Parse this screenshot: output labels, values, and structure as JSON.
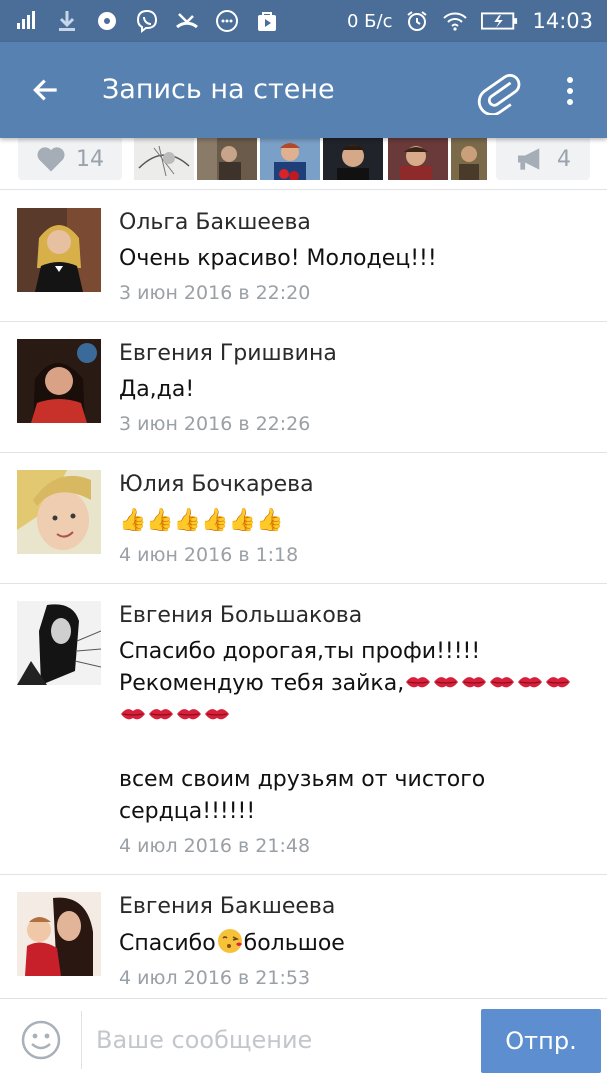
{
  "status_bar": {
    "network_speed": "0 Б/с",
    "time": "14:03",
    "icons": [
      "signal-icon",
      "download-icon",
      "record-icon",
      "viber-icon",
      "missed-call-icon",
      "chat-icon",
      "play-store-icon",
      "alarm-icon",
      "wifi-icon",
      "battery-charging-icon"
    ]
  },
  "app_bar": {
    "title": "Запись на стене",
    "back_icon": "arrow-left-icon",
    "attach_icon": "paperclip-icon",
    "more_icon": "more-vert-icon"
  },
  "likes": {
    "like_count": "14",
    "share_count": "4",
    "like_icon": "heart-icon",
    "share_icon": "megaphone-icon"
  },
  "comments": [
    {
      "author": "Ольга Бакшеева",
      "text": "Очень красиво! Молодец!!!",
      "date": "3 июн 2016 в 22:20"
    },
    {
      "author": "Евгения Гришвина",
      "text": "Да,да!",
      "date": "3 июн 2016 в 22:26"
    },
    {
      "author": "Юлия Бочкарева",
      "text": "👍👍👍👍👍👍",
      "date": "4 июн 2016 в 1:18"
    },
    {
      "author": "Евгения Большакова",
      "text_line1": "Спасибо дорогая,ты профи!!!!!",
      "text_line2": "Рекомендую тебя зайка,",
      "text_line4": "всем своим друзьям от чистого",
      "text_line5": "сердца!!!!!!",
      "date": "4 июл 2016 в 21:48"
    },
    {
      "author": "Евгения Бакшеева",
      "text_before": "Спасибо",
      "text_after": "большое",
      "date": "4 июл 2016 в 21:53"
    }
  ],
  "composer": {
    "placeholder": "Ваше сообщение",
    "send_label": "Отпр.",
    "smile_icon": "smiley-icon"
  },
  "colors": {
    "status_bar": "#4a6e98",
    "app_bar": "#5781b0",
    "send_button": "#5d8fd0",
    "date_text": "#9aa0a6"
  }
}
